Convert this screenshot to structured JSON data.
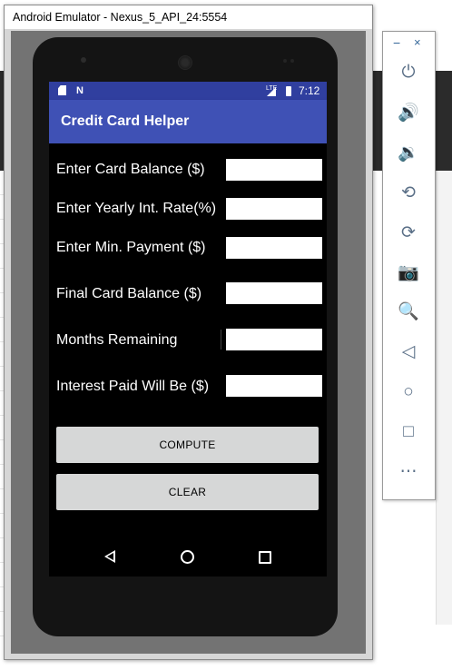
{
  "window": {
    "title": "Android Emulator - Nexus_5_API_24:5554"
  },
  "statusbar": {
    "time": "7:12",
    "lte": "LTE",
    "icons": [
      "sd-card-icon",
      "n-notification-icon",
      "signal-icon",
      "battery-icon"
    ]
  },
  "app": {
    "title": "Credit Card Helper",
    "fields": [
      {
        "label": "Enter Card Balance ($)",
        "value": ""
      },
      {
        "label": "Enter Yearly Int. Rate(%)",
        "value": ""
      },
      {
        "label": "Enter Min. Payment ($)",
        "value": ""
      },
      {
        "label": "Final Card Balance ($)",
        "value": ""
      },
      {
        "label": "Months Remaining",
        "value": ""
      },
      {
        "label": "Interest Paid Will Be ($)",
        "value": ""
      }
    ],
    "buttons": {
      "compute": "COMPUTE",
      "clear": "CLEAR"
    }
  },
  "navbar": {
    "icons": [
      "back-icon",
      "home-icon",
      "recent-apps-icon"
    ]
  },
  "toolbar": {
    "minimize": "−",
    "close": "×",
    "items": [
      {
        "name": "power-icon",
        "glyph": "⏻"
      },
      {
        "name": "volume-up-icon",
        "glyph": "🔊"
      },
      {
        "name": "volume-down-icon",
        "glyph": "🔉"
      },
      {
        "name": "rotate-left-icon",
        "glyph": "⟲"
      },
      {
        "name": "rotate-right-icon",
        "glyph": "⟳"
      },
      {
        "name": "camera-icon",
        "glyph": "📷"
      },
      {
        "name": "zoom-icon",
        "glyph": "🔍"
      },
      {
        "name": "back-icon",
        "glyph": "◁"
      },
      {
        "name": "home-icon",
        "glyph": "○"
      },
      {
        "name": "overview-icon",
        "glyph": "□"
      },
      {
        "name": "more-icon",
        "glyph": "⋯"
      }
    ]
  },
  "colors": {
    "primary": "#3f51b5",
    "primary_dark": "#303f9f",
    "button": "#d6d7d7"
  }
}
